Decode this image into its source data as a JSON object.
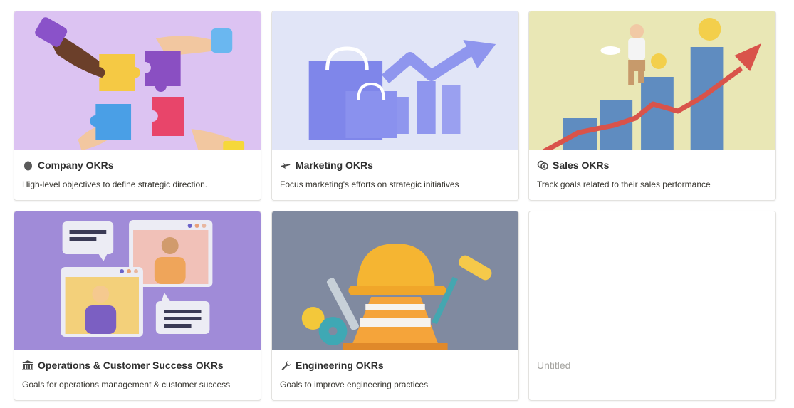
{
  "cards": [
    {
      "title": "Company OKRs",
      "icon": "egg-icon",
      "description": "High-level objectives to define strategic direction.",
      "cover_bg": "#d9bff0"
    },
    {
      "title": "Marketing OKRs",
      "icon": "airplane-icon",
      "description": "Focus marketing's efforts on strategic initiatives",
      "cover_bg": "#dfe3f7"
    },
    {
      "title": "Sales OKRs",
      "icon": "coins-icon",
      "description": "Track goals related to their sales performance",
      "cover_bg": "#e8e6b4"
    },
    {
      "title": "Operations & Customer Success OKRs",
      "icon": "bank-icon",
      "description": "Goals for operations management & customer success",
      "cover_bg": "#9f8bd8"
    },
    {
      "title": "Engineering OKRs",
      "icon": "wrench-icon",
      "description": "Goals to improve engineering practices",
      "cover_bg": "#808aa0"
    },
    {
      "title": "Untitled",
      "icon": "",
      "description": ""
    }
  ]
}
